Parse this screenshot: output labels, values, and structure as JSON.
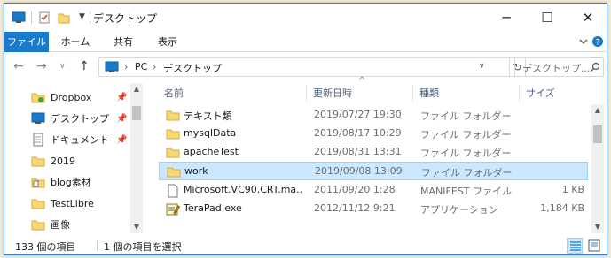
{
  "window": {
    "title": "デスクトップ"
  },
  "ribbon": {
    "tabs": [
      "ファイル",
      "ホーム",
      "共有",
      "表示"
    ]
  },
  "address": {
    "path": [
      "PC",
      "デスクトップ"
    ],
    "search_placeholder": "デスクトップ..."
  },
  "nav_pane": {
    "items": [
      {
        "label": "Dropbox",
        "icon": "dropbox-folder-icon",
        "pinned": true
      },
      {
        "label": "デスクトップ",
        "icon": "desktop-icon",
        "pinned": true
      },
      {
        "label": "ドキュメント",
        "icon": "documents-icon",
        "pinned": true
      },
      {
        "label": "2019",
        "icon": "folder-icon",
        "pinned": false
      },
      {
        "label": "blog素材",
        "icon": "folder-icon",
        "pinned": false
      },
      {
        "label": "TestLibre",
        "icon": "folder-icon",
        "pinned": false
      },
      {
        "label": "画像",
        "icon": "folder-icon",
        "pinned": false
      }
    ]
  },
  "file_list": {
    "columns": {
      "name": "名前",
      "date": "更新日時",
      "type": "種類",
      "size": "サイズ"
    },
    "rows": [
      {
        "name": "テキスト類",
        "date": "2019/07/27 19:30",
        "type": "ファイル フォルダー",
        "size": "",
        "icon": "folder-icon",
        "selected": false
      },
      {
        "name": "mysqlData",
        "date": "2019/08/17 10:29",
        "type": "ファイル フォルダー",
        "size": "",
        "icon": "folder-icon",
        "selected": false
      },
      {
        "name": "apacheTest",
        "date": "2019/08/31 13:31",
        "type": "ファイル フォルダー",
        "size": "",
        "icon": "folder-icon",
        "selected": false
      },
      {
        "name": "work",
        "date": "2019/09/08 13:09",
        "type": "ファイル フォルダー",
        "size": "",
        "icon": "folder-icon",
        "selected": true
      },
      {
        "name": "Microsoft.VC90.CRT.ma...",
        "date": "2011/09/20 1:28",
        "type": "MANIFEST ファイル",
        "size": "1 KB",
        "icon": "file-icon",
        "selected": false
      },
      {
        "name": "TeraPad.exe",
        "date": "2012/11/12 9:21",
        "type": "アプリケーション",
        "size": "1,184 KB",
        "icon": "terapad-app-icon",
        "selected": false
      }
    ]
  },
  "status": {
    "item_count": "133 個の項目",
    "selected_count": "1 個の項目を選択"
  },
  "colors": {
    "accent": "#1979ca",
    "selection": "#cce8ff",
    "folder": "#f8d775"
  }
}
